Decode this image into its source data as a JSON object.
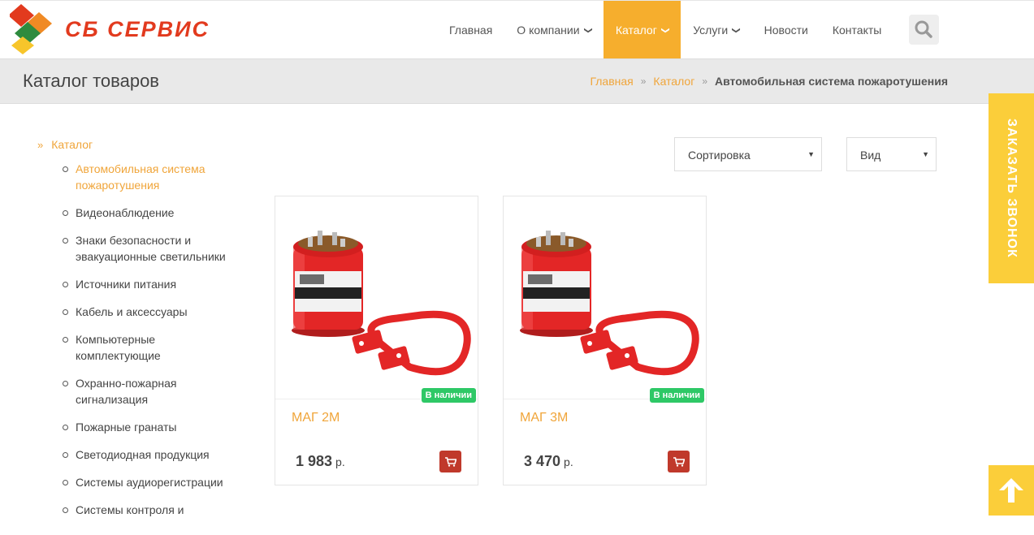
{
  "logo": {
    "text": "СБ СЕРВИС"
  },
  "nav": {
    "items": [
      {
        "label": "Главная",
        "dropdown": false,
        "active": false
      },
      {
        "label": "О компании",
        "dropdown": true,
        "active": false
      },
      {
        "label": "Каталог",
        "dropdown": true,
        "active": true
      },
      {
        "label": "Услуги",
        "dropdown": true,
        "active": false
      },
      {
        "label": "Новости",
        "dropdown": false,
        "active": false
      },
      {
        "label": "Контакты",
        "dropdown": false,
        "active": false
      }
    ],
    "search_icon": "search-icon"
  },
  "titlebar": {
    "title": "Каталог товаров",
    "breadcrumb": {
      "home": "Главная",
      "catalog": "Каталог",
      "current": "Автомобильная система пожаротушения"
    }
  },
  "sidebar": {
    "root": "Каталог",
    "items": [
      "Автомобильная система пожаротушения",
      "Видеонаблюдение",
      "Знаки безопасности и эвакуационные светильники",
      "Источники питания",
      "Кабель и аксессуары",
      "Компьютерные комплектующие",
      "Охранно-пожарная сигнализация",
      "Пожарные гранаты",
      "Светодиодная продукция",
      "Системы аудиорегистрации",
      "Системы контроля и"
    ],
    "active_index": 0
  },
  "filters": {
    "sort": "Сортировка",
    "view": "Вид"
  },
  "products": [
    {
      "name": "МАГ 2М",
      "price": "1 983",
      "currency": "р.",
      "badge": "В наличии"
    },
    {
      "name": "МАГ 3М",
      "price": "3 470",
      "currency": "р.",
      "badge": "В наличии"
    }
  ],
  "widgets": {
    "callback": "ЗАКАЗАТЬ ЗВОНОК"
  },
  "colors": {
    "accent": "#f6ae2d",
    "link": "#f0a53a",
    "badge": "#2ec866",
    "cart": "#c0392b",
    "widget": "#fbce3a"
  }
}
